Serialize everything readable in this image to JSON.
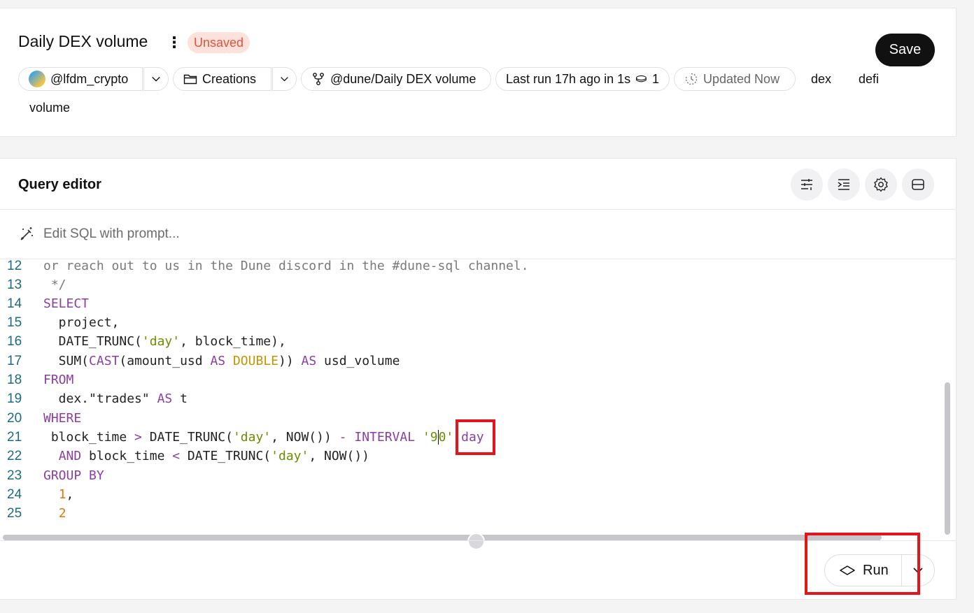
{
  "query": {
    "title": "Daily DEX volume",
    "status_badge": "Unsaved",
    "save_label": "Save",
    "owner": "@lfdm_crypto",
    "folder": "Creations",
    "fork_source": "@dune/Daily DEX volume",
    "last_run": "Last run 17h ago in 1s",
    "credits": "1",
    "updated": "Updated Now",
    "tags": [
      "dex",
      "defi",
      "volume"
    ]
  },
  "editor": {
    "title": "Query editor",
    "prompt_placeholder": "Edit SQL with prompt...",
    "run_label": "Run",
    "lines": [
      {
        "n": "12",
        "text": "or reach out to us in the Dune discord in the #dune-sql channel."
      },
      {
        "n": "13",
        "text": " */"
      },
      {
        "n": "14",
        "text": "SELECT"
      },
      {
        "n": "15",
        "text": "  project,"
      },
      {
        "n": "16",
        "text": "  DATE_TRUNC('day', block_time),"
      },
      {
        "n": "17",
        "text": "  SUM(CAST(amount_usd AS DOUBLE)) AS usd_volume"
      },
      {
        "n": "18",
        "text": "FROM"
      },
      {
        "n": "19",
        "text": "  dex.\"trades\" AS t"
      },
      {
        "n": "20",
        "text": "WHERE"
      },
      {
        "n": "21",
        "text": " block_time > DATE_TRUNC('day', NOW()) - INTERVAL '90' day"
      },
      {
        "n": "22",
        "text": "  AND block_time < DATE_TRUNC('day', NOW())"
      },
      {
        "n": "23",
        "text": "GROUP BY"
      },
      {
        "n": "24",
        "text": "  1,"
      },
      {
        "n": "25",
        "text": "  2"
      }
    ]
  },
  "icons": {
    "kebab": "more-vertical-icon",
    "folder": "folder-icon",
    "fork": "fork-icon",
    "credits": "coins-icon",
    "updated": "clock-refresh-icon",
    "prompt": "magic-wand-icon",
    "toolbar": [
      "sliders-icon",
      "indent-icon",
      "gear-icon",
      "layout-panels-icon"
    ],
    "run": "diamond-play-icon"
  },
  "colors": {
    "accent_badge_bg": "#fde2dc",
    "accent_badge_text": "#e2513e",
    "highlight": "#e3151a",
    "keyword": "#8a3fa0",
    "string": "#6b8e00",
    "number": "#e0770e"
  }
}
